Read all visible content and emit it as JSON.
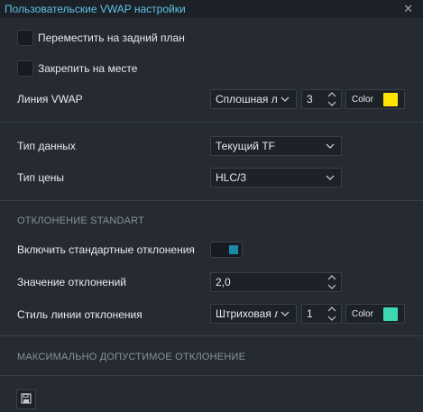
{
  "window": {
    "title": "Пользовательские VWAP настройки",
    "close_glyph": "✕"
  },
  "general": {
    "move_back_label": "Переместить на задний план",
    "move_back_checked": false,
    "lock_label": "Закрепить на месте",
    "lock_checked": false,
    "vwap_line_label": "Линия VWAP",
    "vwap_line_style": "Сплошная линия",
    "vwap_line_width": "3",
    "vwap_color_label": "Color",
    "vwap_color": "#ffe500"
  },
  "data": {
    "data_type_label": "Тип данных",
    "data_type_value": "Текущий TF",
    "price_type_label": "Тип цены",
    "price_type_value": "HLC/3"
  },
  "deviation": {
    "section_title": "ОТКЛОНЕНИЕ STANDART",
    "enable_label": "Включить стандартные отклонения",
    "enable_on": true,
    "value_label": "Значение отклонений",
    "value": "2,0",
    "line_style_label": "Стиль линии отклонения",
    "line_style_value": "Штриховая линия",
    "line_width": "1",
    "color_label": "Color",
    "color": "#3fd6b4"
  },
  "max_deviation": {
    "section_title": "МАКСИМАЛЬНО ДОПУСТИМОЕ ОТКЛОНЕНИЕ"
  },
  "footer": {
    "save_icon": "floppy-disk-icon"
  },
  "colors": {
    "title_accent": "#5fc4e6",
    "background": "#262b33",
    "toggle_on": "#1a8aa8"
  }
}
